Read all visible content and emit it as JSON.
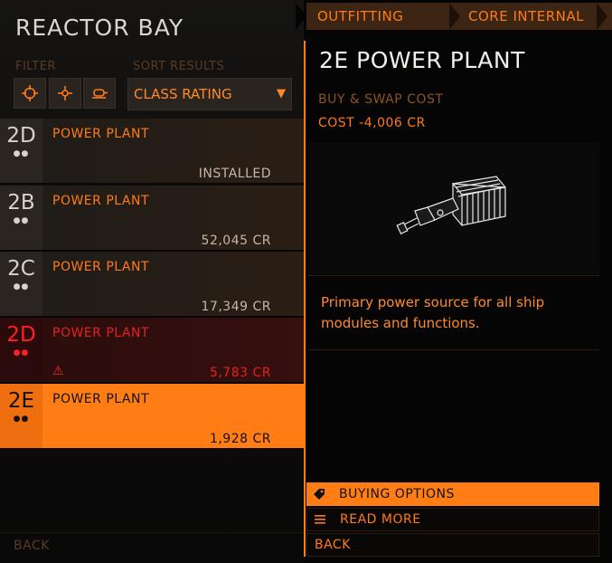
{
  "left": {
    "title": "REACTOR BAY",
    "filter_label": "FILTER",
    "sort_label": "SORT RESULTS",
    "sort_value": "CLASS RATING",
    "filter_icons": [
      "crosshair-icon",
      "move-icon",
      "vehicle-icon"
    ],
    "rows": [
      {
        "class": "2D",
        "dots": "●●",
        "name": "POWER PLANT",
        "price": "INSTALLED",
        "state": "normal",
        "warning": false
      },
      {
        "class": "2B",
        "dots": "●●",
        "name": "POWER PLANT",
        "price": "52,045 CR",
        "state": "normal",
        "warning": false
      },
      {
        "class": "2C",
        "dots": "●●",
        "name": "POWER PLANT",
        "price": "17,349 CR",
        "state": "normal",
        "warning": false
      },
      {
        "class": "2D",
        "dots": "●●",
        "name": "POWER PLANT",
        "price": "5,783 CR",
        "state": "danger",
        "warning": true
      },
      {
        "class": "2E",
        "dots": "●●",
        "name": "POWER PLANT",
        "price": "1,928 CR",
        "state": "selected",
        "warning": false
      }
    ],
    "back": "BACK"
  },
  "right": {
    "tabs": [
      "OUTFITTING",
      "CORE INTERNAL"
    ],
    "module_title": "2E POWER PLANT",
    "buy_swap_label": "BUY & SWAP COST",
    "cost": "COST -4,006 CR",
    "description": "Primary power source for all ship modules and functions.",
    "actions": {
      "buying_options": "BUYING OPTIONS",
      "read_more": "READ MORE",
      "back": "BACK"
    }
  },
  "colors": {
    "accent": "#ff7a18",
    "selected_bg": "#ff7d14",
    "danger": "#e02222",
    "title_text": "#d9d6d2"
  }
}
